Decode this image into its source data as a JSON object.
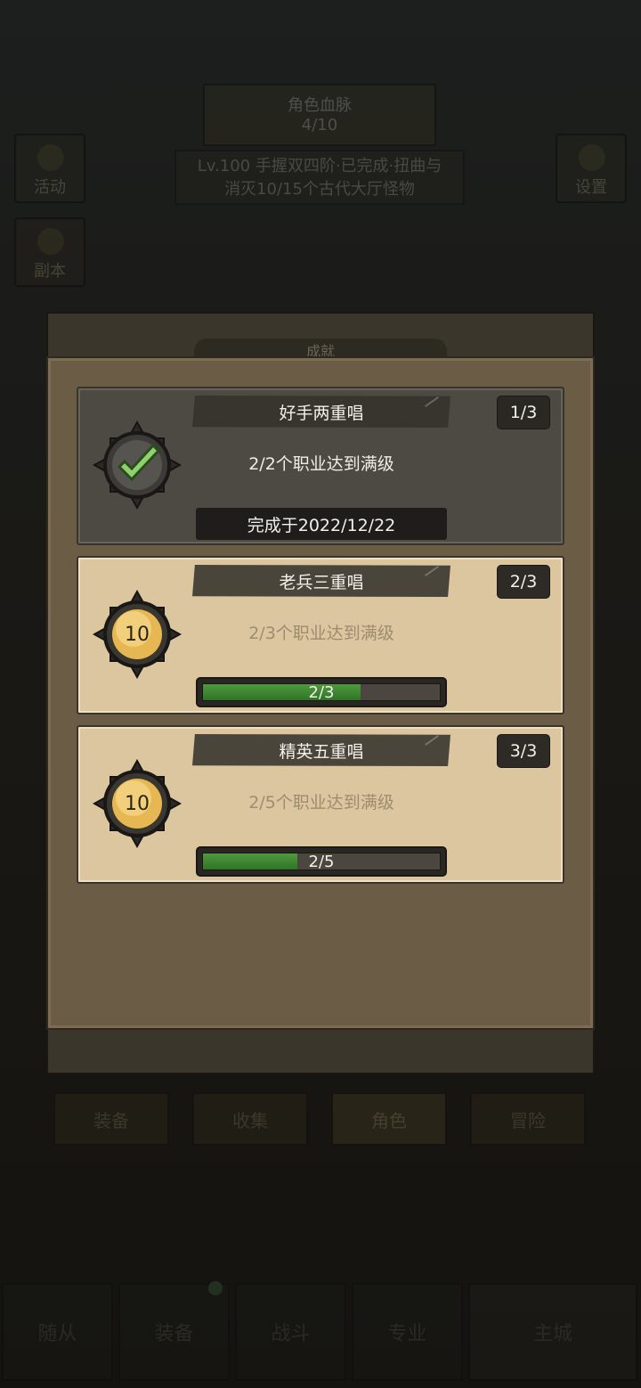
{
  "background": {
    "top_card": {
      "title": "角色血脉",
      "value": "4/10"
    },
    "quest": {
      "line1": "Lv.100 手握双四阶·已完成·扭曲与",
      "line2": "消灭10/15个古代大厅怪物"
    },
    "side_buttons": [
      {
        "label": "活动",
        "icon": "house-icon"
      },
      {
        "label": "副本",
        "icon": "dungeon-icon"
      },
      {
        "label": "设置",
        "icon": "gear-icon"
      }
    ],
    "tabs": [
      "装备",
      "收集",
      "角色",
      "冒险"
    ],
    "active_tab": "角色",
    "bottom_nav": [
      "随从",
      "装备",
      "战斗",
      "专业",
      "主城"
    ]
  },
  "modal": {
    "title": "成就",
    "achievements": [
      {
        "title": "好手两重唱",
        "counter": "1/3",
        "description": "2/2个职业达到满级",
        "status": "completed",
        "completed_text": "完成于2022/12/22",
        "icon": "check-medal-icon"
      },
      {
        "title": "老兵三重唱",
        "counter": "2/3",
        "description": "2/3个职业达到满级",
        "status": "in_progress",
        "reward": "10",
        "progress_label": "2/3",
        "progress": 0.6667,
        "icon": "gold-medal-icon"
      },
      {
        "title": "精英五重唱",
        "counter": "3/3",
        "description": "2/5个职业达到满级",
        "status": "in_progress",
        "reward": "10",
        "progress_label": "2/5",
        "progress": 0.4,
        "icon": "gold-medal-icon"
      }
    ]
  },
  "colors": {
    "progress_fill": "#3f8a33",
    "card_done": "#4d4a43",
    "card_todo": "#dcc6a0",
    "modal_body": "#6b5c45"
  }
}
